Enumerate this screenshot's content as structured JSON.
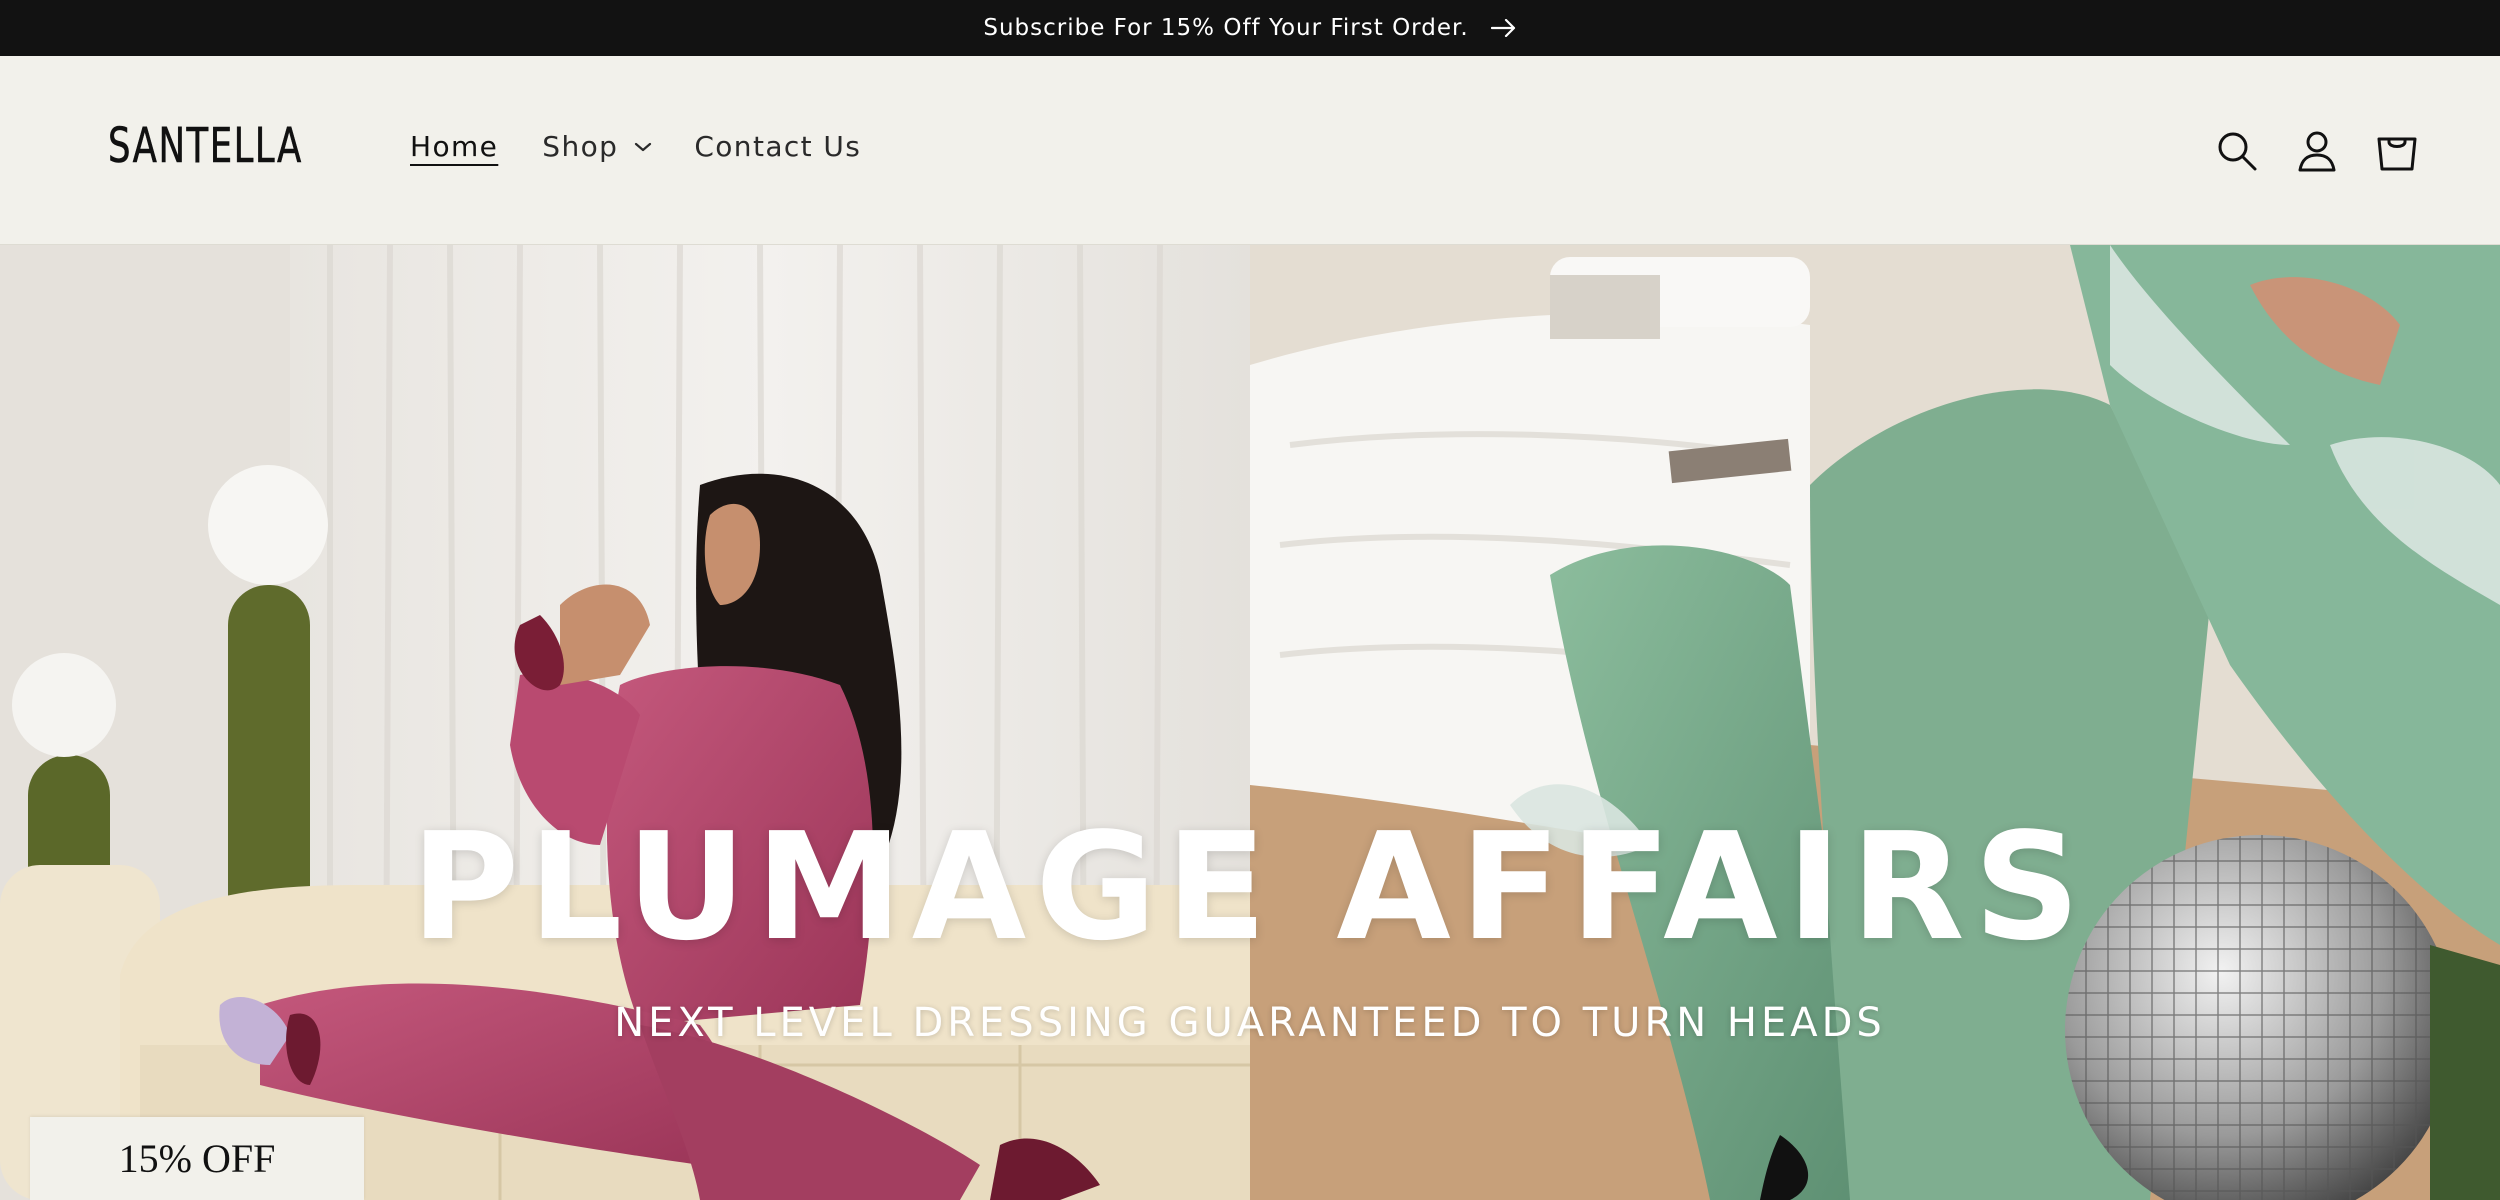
{
  "announcement": {
    "text": "Subscribe For 15% Off Your First Order.",
    "icon": "arrow-right-icon"
  },
  "header": {
    "logo": "SANTELLA",
    "nav": [
      {
        "label": "Home",
        "active": true
      },
      {
        "label": "Shop",
        "has_dropdown": true
      },
      {
        "label": "Contact Us"
      }
    ],
    "icons": [
      "search-icon",
      "account-icon",
      "cart-icon"
    ]
  },
  "hero": {
    "title": "PLUMAGE AFFAIRS",
    "subtitle": "NEXT LEVEL DRESSING GUARANTEED TO TURN HEADS"
  },
  "discount_tab": {
    "label": "15% OFF"
  },
  "colors": {
    "announcement_bg": "#121212",
    "header_bg": "#f2f1eb",
    "text": "#111111",
    "pink_outfit": "#b84a6e",
    "green_outfit": "#7fae90"
  }
}
